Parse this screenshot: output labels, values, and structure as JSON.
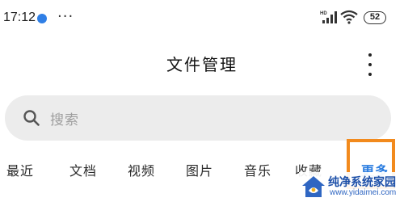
{
  "status_bar": {
    "time": "17:12",
    "more_dots": "···",
    "signal_label": "HD",
    "battery": "52",
    "app_dot_color": "#2f7fe6"
  },
  "header": {
    "title": "文件管理",
    "menu_icon": "more-vertical-icon"
  },
  "search": {
    "placeholder": "搜索",
    "icon": "search-icon"
  },
  "tabs": [
    {
      "label": "最近"
    },
    {
      "label": "文档"
    },
    {
      "label": "视频"
    },
    {
      "label": "图片"
    },
    {
      "label": "音乐"
    },
    {
      "label": "收藏"
    },
    {
      "label": "更多"
    }
  ],
  "highlight_color": "#f28a1d",
  "watermark": {
    "title": "纯净系统家园",
    "url": "www.yidaimei.com"
  }
}
